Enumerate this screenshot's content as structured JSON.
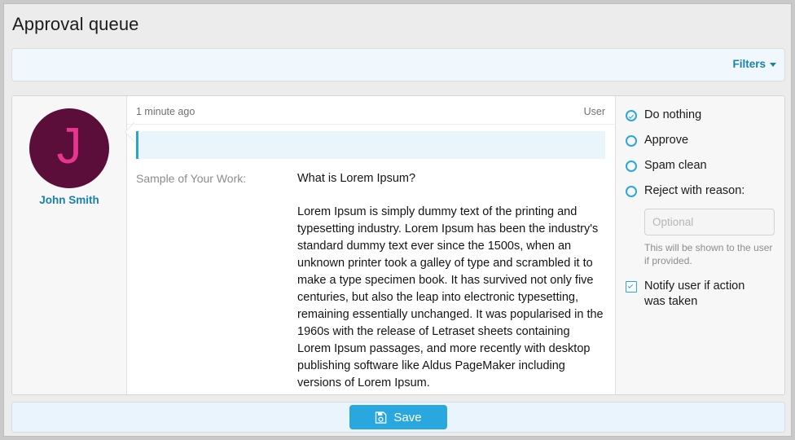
{
  "page": {
    "title": "Approval queue"
  },
  "filters": {
    "label": "Filters",
    "caret_icon": "chevron-down-icon"
  },
  "card": {
    "author": {
      "avatar_letter": "J",
      "name": "John Smith",
      "avatar_bg": "#5c0e3a",
      "avatar_fg": "#e8368f"
    },
    "meta": {
      "time": "1 minute ago",
      "role": "User"
    },
    "highlight_bar": {
      "value": "",
      "accent": "#24a8cf"
    },
    "field": {
      "label": "Sample of Your Work:",
      "heading": "What is Lorem Ipsum?",
      "body": "Lorem Ipsum is simply dummy text of the printing and typesetting industry. Lorem Ipsum has been the industry's standard dummy text ever since the 1500s, when an unknown printer took a galley of type and scrambled it to make a type specimen book. It has survived not only five centuries, but also the leap into electronic typesetting, remaining essentially unchanged. It was popularised in the 1960s with the release of Letraset sheets containing Lorem Ipsum passages, and more recently with desktop publishing software like Aldus PageMaker including versions of Lorem Ipsum."
    },
    "actions": {
      "options": [
        {
          "label": "Do nothing",
          "selected": true
        },
        {
          "label": "Approve",
          "selected": false
        },
        {
          "label": "Spam clean",
          "selected": false
        },
        {
          "label": "Reject with reason:",
          "selected": false
        }
      ],
      "reason_input": {
        "value": "",
        "placeholder": "Optional"
      },
      "hint": "This will be shown to the user if provided.",
      "notify": {
        "label": "Notify user if action was taken",
        "checked": true
      },
      "accent": "#29a8e0"
    }
  },
  "footer": {
    "save_label": "Save",
    "save_icon": "save-floppy-icon",
    "save_bg": "#29a8e0"
  }
}
